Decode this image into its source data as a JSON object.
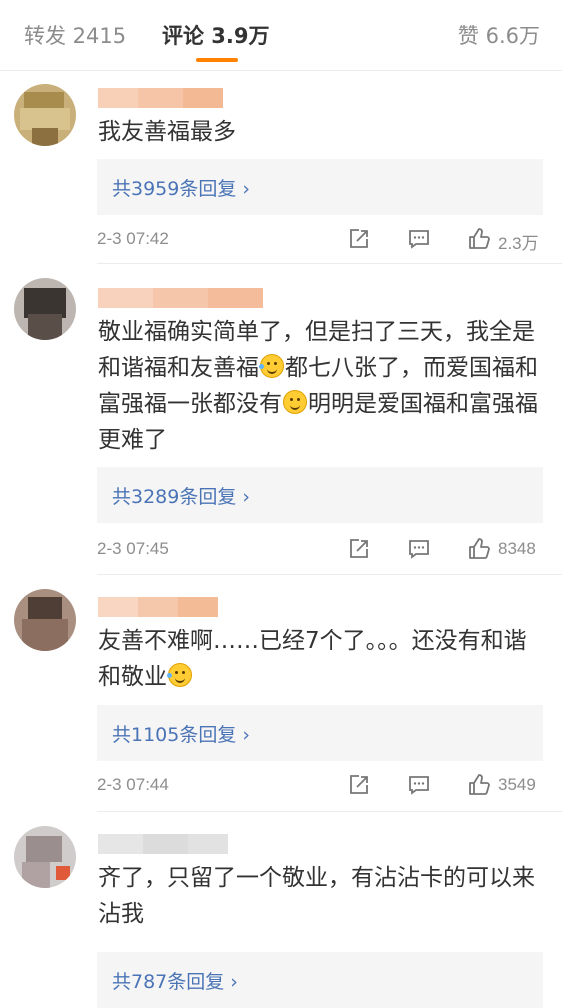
{
  "tabs": {
    "repost": "转发 2415",
    "comment": "评论 3.9万",
    "like": "赞 6.6万"
  },
  "comments": [
    {
      "text_parts": [
        "我友善福最多"
      ],
      "reply_label": "共3959条回复 ›",
      "time": "2-3 07:42",
      "likes": "2.3万"
    },
    {
      "text_parts": [
        "敬业福确实简单了，但是扫了三天，我全是和谐福和友善福",
        "都七八张了，而爱国福和富强福一张都没有",
        "明明是爱国福和富强福更难了"
      ],
      "reply_label": "共3289条回复 ›",
      "time": "2-3 07:45",
      "likes": "8348"
    },
    {
      "text_parts": [
        "友善不难啊……已经7个了。。。还没有和谐和敬业"
      ],
      "reply_label": "共1105条回复 ›",
      "time": "2-3 07:44",
      "likes": "3549"
    },
    {
      "text_parts": [
        "齐了，只留了一个敬业，有沾沾卡的可以来沾我"
      ],
      "reply_label": "共787条回复 ›"
    }
  ],
  "icons": {
    "share": "share-icon",
    "comment": "comment-icon",
    "like": "thumbs-up-icon",
    "emoji_laugh": "laugh-cry-emoji",
    "emoji_smile": "smile-emoji"
  },
  "colors": {
    "accent": "#ff8200",
    "link": "#4b74b7",
    "muted": "#8d8d8d"
  }
}
